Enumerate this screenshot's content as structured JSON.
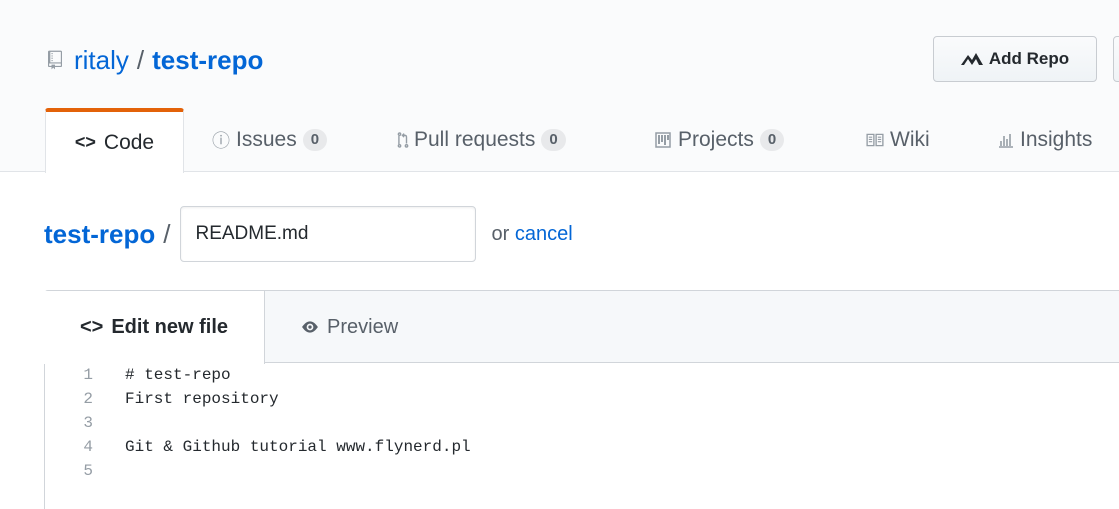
{
  "repo": {
    "owner": "ritaly",
    "separator": "/",
    "name": "test-repo"
  },
  "header_button": {
    "label": "Add Repo"
  },
  "nav_tabs": [
    {
      "label": "Code",
      "icon": "code-icon",
      "selected": true
    },
    {
      "label": "Issues",
      "count": "0",
      "icon": "issue-icon"
    },
    {
      "label": "Pull requests",
      "count": "0",
      "icon": "pull-request-icon"
    },
    {
      "label": "Projects",
      "count": "0",
      "icon": "project-icon"
    },
    {
      "label": "Wiki",
      "icon": "book-icon"
    },
    {
      "label": "Insights",
      "icon": "graph-icon"
    }
  ],
  "path": {
    "repo": "test-repo",
    "separator": "/",
    "filename_value": "README.md",
    "or_text": "or",
    "cancel_label": "cancel"
  },
  "editor": {
    "tabs": {
      "edit_label": "Edit new file",
      "preview_label": "Preview"
    },
    "lines": [
      {
        "number": "1",
        "text": "# test-repo"
      },
      {
        "number": "2",
        "text": "First repository"
      },
      {
        "number": "3",
        "text": ""
      },
      {
        "number": "4",
        "text": "Git & Github tutorial www.flynerd.pl"
      },
      {
        "number": "5",
        "text": ""
      }
    ]
  },
  "colors": {
    "link": "#0366d6",
    "selected_tab_accent": "#e36209",
    "text": "#24292e",
    "muted": "#586069"
  }
}
